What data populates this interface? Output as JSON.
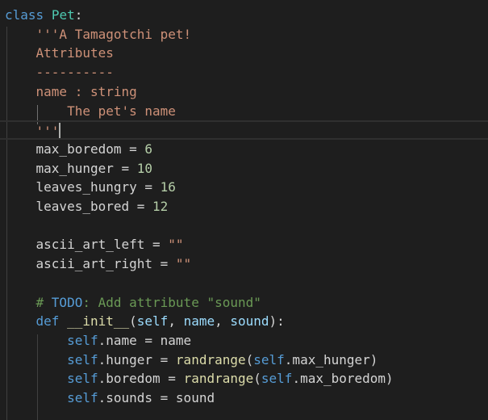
{
  "editor": {
    "language": "python",
    "theme_colors": {
      "background": "#1e1e1e",
      "keyword": "#569cd6",
      "class_name": "#4ec9b0",
      "string": "#ce9178",
      "number": "#b5cea8",
      "comment": "#6a9955",
      "function": "#dcdcaa",
      "parameter": "#9cdcfe",
      "text": "#d4d4d4"
    },
    "lines": [
      {
        "tokens": [
          {
            "t": "class",
            "c": "kw"
          },
          {
            "t": " ",
            "c": "pl"
          },
          {
            "t": "Pet",
            "c": "cls"
          },
          {
            "t": ":",
            "c": "pl"
          }
        ]
      },
      {
        "tokens": [
          {
            "t": "    '''A Tamagotchi pet!",
            "c": "str"
          }
        ]
      },
      {
        "tokens": [
          {
            "t": "    Attributes",
            "c": "str"
          }
        ]
      },
      {
        "tokens": [
          {
            "t": "    ----------",
            "c": "str"
          }
        ]
      },
      {
        "tokens": [
          {
            "t": "    name : string",
            "c": "str"
          }
        ]
      },
      {
        "tokens": [
          {
            "t": "        The pet's name",
            "c": "str"
          }
        ]
      },
      {
        "tokens": [
          {
            "t": "    '''",
            "c": "str"
          }
        ],
        "current": true
      },
      {
        "tokens": [
          {
            "t": "    max_boredom = ",
            "c": "pl"
          },
          {
            "t": "6",
            "c": "num"
          }
        ]
      },
      {
        "tokens": [
          {
            "t": "    max_hunger = ",
            "c": "pl"
          },
          {
            "t": "10",
            "c": "num"
          }
        ]
      },
      {
        "tokens": [
          {
            "t": "    leaves_hungry = ",
            "c": "pl"
          },
          {
            "t": "16",
            "c": "num"
          }
        ]
      },
      {
        "tokens": [
          {
            "t": "    leaves_bored = ",
            "c": "pl"
          },
          {
            "t": "12",
            "c": "num"
          }
        ]
      },
      {
        "tokens": []
      },
      {
        "tokens": [
          {
            "t": "    ascii_art_left = ",
            "c": "pl"
          },
          {
            "t": "\"\"",
            "c": "str"
          }
        ]
      },
      {
        "tokens": [
          {
            "t": "    ascii_art_right = ",
            "c": "pl"
          },
          {
            "t": "\"\"",
            "c": "str"
          }
        ]
      },
      {
        "tokens": []
      },
      {
        "tokens": [
          {
            "t": "    # ",
            "c": "cmt"
          },
          {
            "t": "TODO",
            "c": "todo"
          },
          {
            "t": ": Add attribute \"sound\"",
            "c": "cmt"
          }
        ]
      },
      {
        "tokens": [
          {
            "t": "    ",
            "c": "pl"
          },
          {
            "t": "def",
            "c": "kw"
          },
          {
            "t": " ",
            "c": "pl"
          },
          {
            "t": "__init__",
            "c": "fn"
          },
          {
            "t": "(",
            "c": "pl"
          },
          {
            "t": "self",
            "c": "prm"
          },
          {
            "t": ", ",
            "c": "pl"
          },
          {
            "t": "name",
            "c": "prm"
          },
          {
            "t": ", ",
            "c": "pl"
          },
          {
            "t": "sound",
            "c": "prm"
          },
          {
            "t": "):",
            "c": "pl"
          }
        ]
      },
      {
        "tokens": [
          {
            "t": "        ",
            "c": "pl"
          },
          {
            "t": "self",
            "c": "self"
          },
          {
            "t": ".name = name",
            "c": "pl"
          }
        ]
      },
      {
        "tokens": [
          {
            "t": "        ",
            "c": "pl"
          },
          {
            "t": "self",
            "c": "self"
          },
          {
            "t": ".hunger = ",
            "c": "pl"
          },
          {
            "t": "randrange",
            "c": "fn"
          },
          {
            "t": "(",
            "c": "pl"
          },
          {
            "t": "self",
            "c": "self"
          },
          {
            "t": ".max_hunger)",
            "c": "pl"
          }
        ]
      },
      {
        "tokens": [
          {
            "t": "        ",
            "c": "pl"
          },
          {
            "t": "self",
            "c": "self"
          },
          {
            "t": ".boredom = ",
            "c": "pl"
          },
          {
            "t": "randrange",
            "c": "fn"
          },
          {
            "t": "(",
            "c": "pl"
          },
          {
            "t": "self",
            "c": "self"
          },
          {
            "t": ".max_boredom)",
            "c": "pl"
          }
        ]
      },
      {
        "tokens": [
          {
            "t": "        ",
            "c": "pl"
          },
          {
            "t": "self",
            "c": "self"
          },
          {
            "t": ".sounds = sound",
            "c": "pl"
          }
        ]
      }
    ]
  }
}
